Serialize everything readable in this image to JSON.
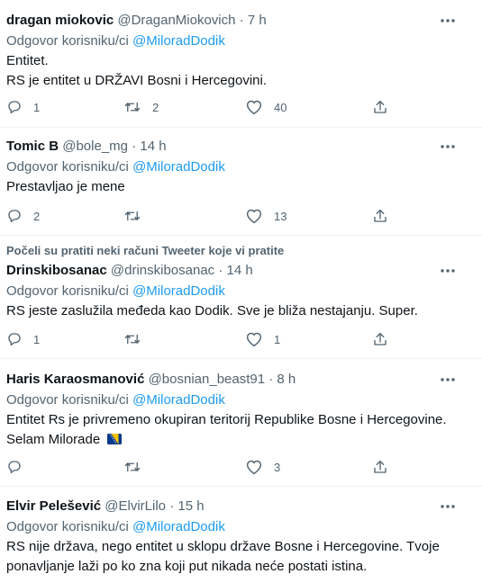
{
  "labels": {
    "reply_prefix": "Odgovor korisniku/ci",
    "separator": "·"
  },
  "tweets": [
    {
      "name": "dragan miokovic",
      "handle": "@DraganMiokovich",
      "time": "7 h",
      "reply_to": "@MiloradDodik",
      "lines": [
        "Entitet.",
        "RS je entitet u DRŽAVI Bosni i Hercegovini."
      ],
      "replies": "1",
      "retweets": "2",
      "likes": "40"
    },
    {
      "name": "Tomic B",
      "handle": "@bole_mg",
      "time": "14 h",
      "reply_to": "@MiloradDodik",
      "lines": [
        "Prestavljao je mene"
      ],
      "replies": "2",
      "retweets": "",
      "likes": "13"
    },
    {
      "social_context": "Počeli su pratiti neki računi Tweeter koje vi pratite",
      "name": "Drinskibosanac",
      "handle": "@drinskibosanac",
      "time": "14 h",
      "reply_to": "@MiloradDodik",
      "lines": [
        "RS jeste zaslužila međeda kao Dodik. Sve je bliža nestajanju. Super."
      ],
      "replies": "1",
      "retweets": "",
      "likes": "1"
    },
    {
      "name": "Haris Karaosmanović",
      "handle": "@bosnian_beast91",
      "time": "8 h",
      "reply_to": "@MiloradDodik",
      "lines": [
        "Entitet Rs je privremeno okupiran teritorij Republike Bosne i Hercegovine.",
        "Selam Milorade"
      ],
      "flag_icon": "bosnia-flag-emoji",
      "replies": "",
      "retweets": "",
      "likes": "3"
    },
    {
      "name": "Elvir Pelešević",
      "handle": "@ElvirLilo",
      "time": "15 h",
      "reply_to": "@MiloradDodik",
      "lines": [
        "RS nije država, nego entitet u sklopu države Bosne i Hercegovine. Tvoje",
        "ponavljanje laži po ko zna koji put nikada neće postati istina."
      ]
    }
  ],
  "icons": {
    "more": "more-icon",
    "reply": "reply-icon",
    "retweet": "retweet-icon",
    "like": "heart-icon",
    "share": "share-icon"
  },
  "colors": {
    "link": "#1d9bf0",
    "muted": "#536471",
    "text": "#0f1419",
    "divider": "#eff3f4"
  }
}
